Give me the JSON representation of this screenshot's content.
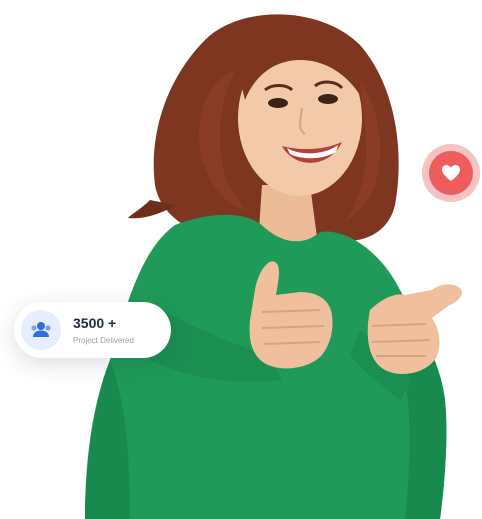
{
  "stat_card": {
    "value": "3500 +",
    "label": "Project Delivered",
    "icon": "users-icon",
    "icon_color": "#2f6fdd"
  },
  "badge": {
    "icon": "heart-icon",
    "color": "#ee5c5c"
  },
  "colors": {
    "sweater": "#1f9a58",
    "hair": "#8a3d24",
    "skin": "#f2c9a9"
  }
}
